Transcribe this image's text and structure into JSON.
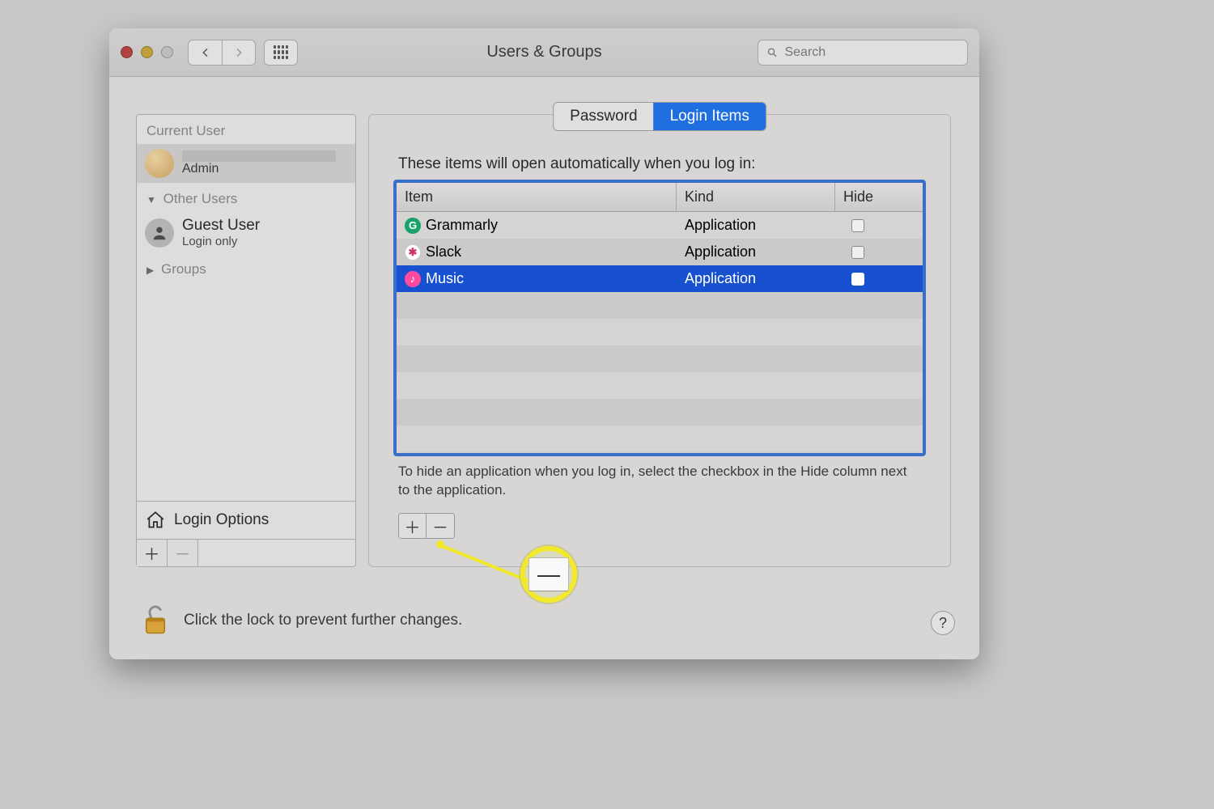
{
  "window": {
    "title": "Users & Groups"
  },
  "search": {
    "placeholder": "Search"
  },
  "sidebar": {
    "sections": {
      "current_label": "Current User",
      "other_label": "Other Users",
      "groups_label": "Groups"
    },
    "current_user": {
      "name_redacted": true,
      "role": "Admin"
    },
    "other_users": [
      {
        "name": "Guest User",
        "sub": "Login only"
      }
    ],
    "login_options_label": "Login Options"
  },
  "tabs": {
    "password": "Password",
    "login_items": "Login Items",
    "active": "login_items"
  },
  "login_items": {
    "intro": "These items will open automatically when you log in:",
    "columns": {
      "item": "Item",
      "kind": "Kind",
      "hide": "Hide"
    },
    "rows": [
      {
        "name": "Grammarly",
        "kind": "Application",
        "hide": false,
        "icon_bg": "#17a36a",
        "icon_glyph": "G",
        "selected": false
      },
      {
        "name": "Slack",
        "kind": "Application",
        "hide": false,
        "icon_bg": "#ffffff",
        "icon_glyph": "✱",
        "selected": false
      },
      {
        "name": "Music",
        "kind": "Application",
        "hide": false,
        "icon_bg": "#ff4a9e",
        "icon_glyph": "♪",
        "selected": true
      }
    ],
    "hint": "To hide an application when you log in, select the checkbox in the Hide column next to the application."
  },
  "lock": {
    "text": "Click the lock to prevent further changes.",
    "locked": false
  },
  "help_glyph": "?",
  "callout": {
    "target": "remove-login-item-button"
  }
}
